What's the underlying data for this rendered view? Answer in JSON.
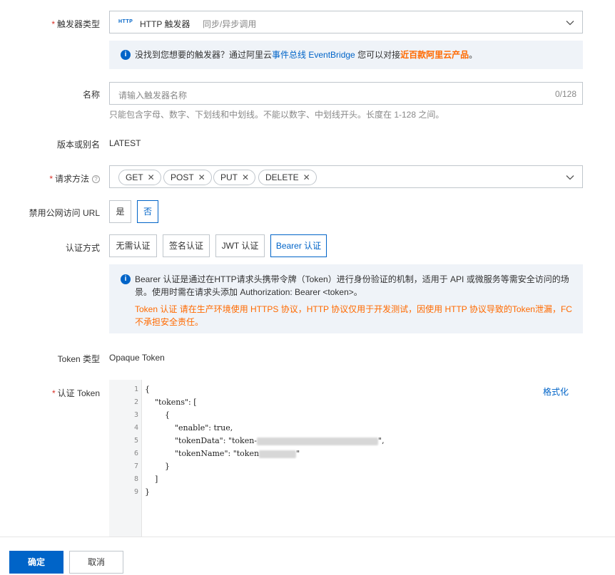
{
  "trigger_type": {
    "label": "触发器类型",
    "badge": "HTTP",
    "value": "HTTP 触发器",
    "description": "同步/异步调用"
  },
  "eventbridge_notice": {
    "text_before": "没找到您想要的触发器？通过阿里云",
    "link": "事件总线 EventBridge",
    "text_middle": " 您可以对接",
    "highlight": "近百款阿里云产品",
    "text_after": "。"
  },
  "name_field": {
    "label": "名称",
    "placeholder": "请输入触发器名称",
    "counter": "0/128",
    "help": "只能包含字母、数字、下划线和中划线。不能以数字、中划线开头。长度在 1-128 之间。"
  },
  "version": {
    "label": "版本或别名",
    "value": "LATEST"
  },
  "request_methods": {
    "label": "请求方法",
    "help_icon": "question-circle-icon",
    "tags": [
      "GET",
      "POST",
      "PUT",
      "DELETE"
    ],
    "remove_glyph": "✕"
  },
  "disable_public_url": {
    "label": "禁用公网访问 URL",
    "options": [
      "是",
      "否"
    ],
    "selected": "否"
  },
  "auth_method": {
    "label": "认证方式",
    "options": [
      "无需认证",
      "签名认证",
      "JWT 认证",
      "Bearer 认证"
    ],
    "selected": "Bearer 认证"
  },
  "bearer_notice": {
    "line1": "Bearer 认证是通过在HTTP请求头携带令牌（Token）进行身份验证的机制，适用于 API 或微服务等需安全访问的场",
    "line2": "景。使用时需在请求头添加 Authorization: Bearer <token>。",
    "warn1": "Token 认证 请在生产环境使用 HTTPS 协议，HTTP 协议仅用于开发测试，因使用 HTTP 协议导致的Token泄漏，FC",
    "warn2": "不承担安全责任。"
  },
  "token_type": {
    "label": "Token 类型",
    "value": "Opaque Token"
  },
  "auth_token": {
    "label": "认证 Token",
    "format_link": "格式化",
    "line_numbers": [
      "1",
      "2",
      "3",
      "4",
      "5",
      "6",
      "7",
      "8",
      "9"
    ],
    "lines": [
      "{",
      "    \"tokens\": [",
      "        {",
      "            \"enable\": true,",
      "            \"tokenData\": \"token-",
      "            \"tokenName\": \"token",
      "        }",
      "    ]",
      "}"
    ],
    "line5_suffix": "\",",
    "line6_suffix": "\""
  },
  "footer": {
    "confirm": "确定",
    "cancel": "取消"
  },
  "colors": {
    "primary": "#0064c8",
    "accent_orange": "#ff6a00",
    "required": "#d93026"
  }
}
